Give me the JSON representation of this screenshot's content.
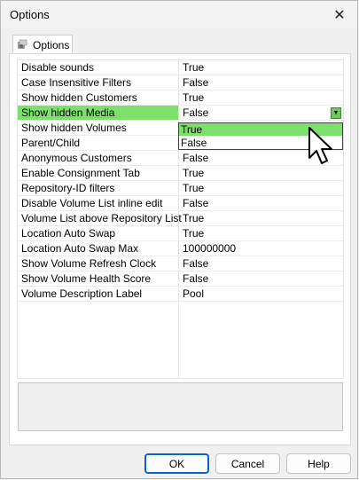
{
  "window": {
    "title": "Options"
  },
  "tab": {
    "label": "Options"
  },
  "grid": {
    "rows": [
      {
        "name": "Disable sounds",
        "value": "True"
      },
      {
        "name": "Case Insensitive Filters",
        "value": "False"
      },
      {
        "name": "Show hidden Customers",
        "value": "True"
      },
      {
        "name": "Show hidden Media",
        "value": "False"
      },
      {
        "name": "Show hidden Volumes",
        "value": ""
      },
      {
        "name": "Parent/Child",
        "value": ""
      },
      {
        "name": "Anonymous Customers",
        "value": "False"
      },
      {
        "name": "Enable Consignment Tab",
        "value": "True"
      },
      {
        "name": "Repository-ID filters",
        "value": "True"
      },
      {
        "name": "Disable Volume List inline edit",
        "value": "False"
      },
      {
        "name": "Volume List above Repository List",
        "value": "True"
      },
      {
        "name": "Location Auto Swap",
        "value": "True"
      },
      {
        "name": "Location Auto Swap Max",
        "value": "100000000"
      },
      {
        "name": "Show Volume Refresh Clock",
        "value": "False"
      },
      {
        "name": "Show Volume Health Score",
        "value": "False"
      },
      {
        "name": "Volume Description Label",
        "value": "Pool"
      }
    ],
    "selected_row_color": "#7de06a"
  },
  "dropdown": {
    "options": [
      "True",
      "False"
    ],
    "highlighted": "True"
  },
  "buttons": {
    "ok": "OK",
    "cancel": "Cancel",
    "help": "Help"
  }
}
